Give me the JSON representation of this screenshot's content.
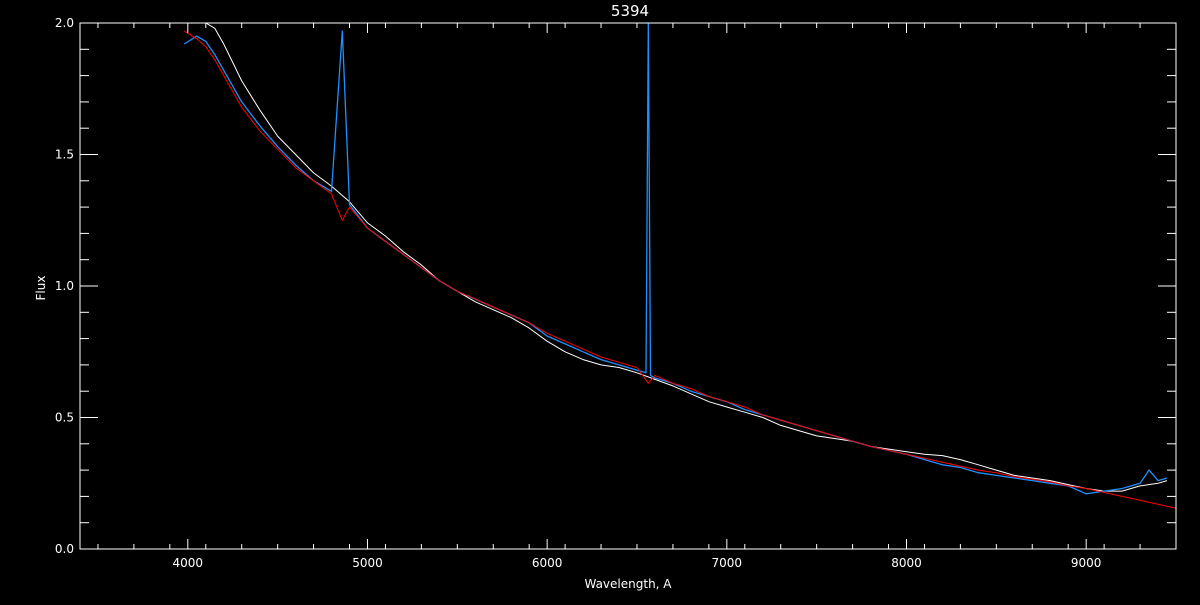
{
  "chart_data": {
    "type": "line",
    "title": "5394",
    "xlabel": "Wavelength, A",
    "ylabel": "Flux",
    "xlim": [
      3400,
      9500
    ],
    "ylim": [
      0.0,
      2.0
    ],
    "x_ticks": [
      4000,
      5000,
      6000,
      7000,
      8000,
      9000
    ],
    "x_tick_labels": [
      "4000",
      "5000",
      "6000",
      "7000",
      "8000",
      "9000"
    ],
    "y_ticks": [
      0.0,
      0.5,
      1.0,
      1.5,
      2.0
    ],
    "y_tick_labels": [
      "0.0",
      "0.5",
      "1.0",
      "1.5",
      "2.0"
    ],
    "grid": false,
    "background_color": "#000000",
    "axis_color": "#ffffff",
    "series": [
      {
        "color": "#ffffff",
        "x": [
          3980,
          4050,
          4100,
          4150,
          4200,
          4250,
          4300,
          4400,
          4500,
          4600,
          4700,
          4800,
          4900,
          5000,
          5100,
          5200,
          5300,
          5400,
          5500,
          5600,
          5700,
          5800,
          5900,
          6000,
          6100,
          6200,
          6300,
          6400,
          6500,
          6600,
          6700,
          6800,
          6900,
          7000,
          7100,
          7200,
          7300,
          7400,
          7500,
          7600,
          7700,
          7800,
          7900,
          8000,
          8100,
          8200,
          8300,
          8400,
          8500,
          8600,
          8700,
          8800,
          8900,
          9000,
          9100,
          9200,
          9300,
          9400,
          9450
        ],
        "y": [
          2.0,
          2.0,
          2.0,
          1.98,
          1.92,
          1.85,
          1.78,
          1.67,
          1.57,
          1.5,
          1.43,
          1.38,
          1.32,
          1.24,
          1.19,
          1.13,
          1.08,
          1.02,
          0.98,
          0.94,
          0.91,
          0.88,
          0.84,
          0.79,
          0.75,
          0.72,
          0.7,
          0.69,
          0.67,
          0.645,
          0.62,
          0.59,
          0.56,
          0.54,
          0.52,
          0.5,
          0.47,
          0.45,
          0.43,
          0.42,
          0.41,
          0.39,
          0.38,
          0.37,
          0.36,
          0.355,
          0.34,
          0.32,
          0.3,
          0.28,
          0.27,
          0.26,
          0.245,
          0.23,
          0.22,
          0.22,
          0.24,
          0.25,
          0.26
        ]
      },
      {
        "color": "#1e90ff",
        "x": [
          3980,
          4050,
          4100,
          4150,
          4200,
          4250,
          4300,
          4400,
          4500,
          4600,
          4700,
          4800,
          4860,
          4900,
          5000,
          5100,
          5200,
          5300,
          5400,
          5500,
          5600,
          5700,
          5800,
          5900,
          6000,
          6100,
          6200,
          6300,
          6400,
          6500,
          6550,
          6563,
          6575,
          6600,
          6700,
          6800,
          6900,
          7000,
          7100,
          7200,
          7300,
          7400,
          7500,
          7600,
          7700,
          7800,
          7900,
          8000,
          8100,
          8200,
          8300,
          8400,
          8500,
          8600,
          8700,
          8800,
          8900,
          9000,
          9100,
          9200,
          9300,
          9350,
          9400,
          9450
        ],
        "y": [
          1.92,
          1.95,
          1.93,
          1.88,
          1.82,
          1.76,
          1.7,
          1.61,
          1.53,
          1.46,
          1.4,
          1.36,
          1.97,
          1.31,
          1.22,
          1.17,
          1.12,
          1.07,
          1.02,
          0.98,
          0.95,
          0.92,
          0.89,
          0.86,
          0.81,
          0.78,
          0.75,
          0.72,
          0.7,
          0.68,
          0.67,
          2.0,
          0.66,
          0.65,
          0.63,
          0.6,
          0.58,
          0.56,
          0.53,
          0.51,
          0.49,
          0.47,
          0.45,
          0.43,
          0.41,
          0.39,
          0.375,
          0.36,
          0.34,
          0.32,
          0.31,
          0.29,
          0.28,
          0.27,
          0.26,
          0.25,
          0.24,
          0.21,
          0.22,
          0.23,
          0.25,
          0.3,
          0.26,
          0.27
        ]
      },
      {
        "color": "#ff0000",
        "x": [
          3980,
          4050,
          4100,
          4150,
          4200,
          4250,
          4300,
          4400,
          4500,
          4600,
          4700,
          4800,
          4860,
          4900,
          5000,
          5100,
          5200,
          5300,
          5400,
          5500,
          5600,
          5700,
          5800,
          5900,
          6000,
          6100,
          6200,
          6300,
          6400,
          6500,
          6563,
          6600,
          6700,
          6800,
          6900,
          7000,
          7100,
          7200,
          7300,
          7400,
          7500,
          7600,
          7700,
          7800,
          7900,
          8000,
          8100,
          8200,
          8300,
          8400,
          8500,
          8600,
          8700,
          8800,
          8900,
          9000,
          9100,
          9200,
          9300,
          9400,
          9500
        ],
        "y": [
          1.97,
          1.94,
          1.91,
          1.86,
          1.8,
          1.74,
          1.68,
          1.59,
          1.52,
          1.45,
          1.4,
          1.35,
          1.25,
          1.3,
          1.22,
          1.17,
          1.12,
          1.07,
          1.02,
          0.98,
          0.95,
          0.92,
          0.89,
          0.86,
          0.82,
          0.79,
          0.76,
          0.73,
          0.71,
          0.69,
          0.63,
          0.66,
          0.63,
          0.61,
          0.58,
          0.56,
          0.54,
          0.51,
          0.49,
          0.47,
          0.45,
          0.43,
          0.41,
          0.39,
          0.375,
          0.36,
          0.345,
          0.33,
          0.315,
          0.3,
          0.29,
          0.275,
          0.265,
          0.255,
          0.24,
          0.23,
          0.215,
          0.2,
          0.185,
          0.17,
          0.155
        ]
      }
    ]
  }
}
